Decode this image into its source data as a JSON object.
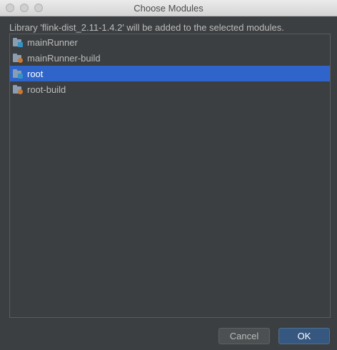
{
  "window": {
    "title": "Choose Modules"
  },
  "description": "Library 'flink-dist_2.11-1.4.2' will be added to the selected modules.",
  "modules": [
    {
      "label": "mainRunner",
      "icon": "module-folder-icon",
      "selected": false
    },
    {
      "label": "mainRunner-build",
      "icon": "build-module-folder-icon",
      "selected": false
    },
    {
      "label": "root",
      "icon": "module-folder-icon",
      "selected": true
    },
    {
      "label": "root-build",
      "icon": "build-module-folder-icon",
      "selected": false
    }
  ],
  "buttons": {
    "cancel": "Cancel",
    "ok": "OK"
  },
  "colors": {
    "background": "#3c3f41",
    "selection": "#2f65ca",
    "ok_button": "#365880",
    "module_badge": "#3592c4",
    "build_badge": "#cc7832"
  }
}
